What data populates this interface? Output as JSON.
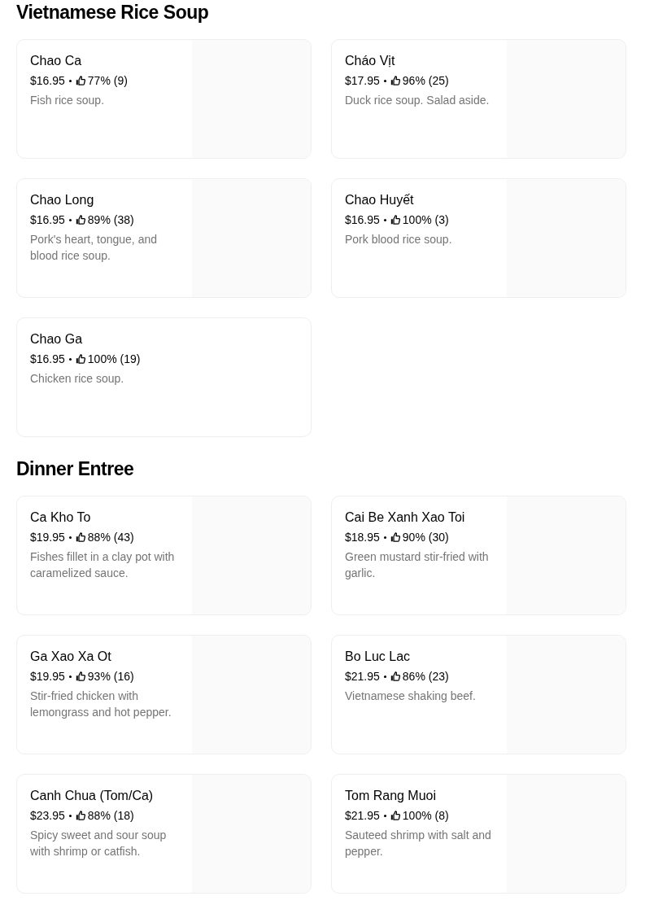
{
  "sections": [
    {
      "title": "Vietnamese Rice Soup",
      "items": [
        {
          "kind": "with-image",
          "name": "Chao Ca",
          "price": "$16.95",
          "rating": "77% (9)",
          "description": "Fish rice soup."
        },
        {
          "kind": "with-image",
          "name": "Cháo Vịt",
          "price": "$17.95",
          "rating": "96% (25)",
          "description": "Duck rice soup. Salad aside."
        },
        {
          "kind": "with-image",
          "name": "Chao Long",
          "price": "$16.95",
          "rating": "89% (38)",
          "description": "Pork's heart, tongue, and blood rice soup."
        },
        {
          "kind": "with-image",
          "name": "Chao Huyết",
          "price": "$16.95",
          "rating": "100% (3)",
          "description": "Pork blood rice soup."
        },
        {
          "kind": "text-only",
          "name": "Chao Ga",
          "price": "$16.95",
          "rating": "100% (19)",
          "description": "Chicken rice soup."
        }
      ]
    },
    {
      "title": "Dinner Entree",
      "items": [
        {
          "kind": "with-image",
          "name": "Ca Kho To",
          "price": "$19.95",
          "rating": "88% (43)",
          "description": "Fishes fillet in a clay pot with caramelized sauce."
        },
        {
          "kind": "with-image",
          "name": "Cai Be Xanh Xao Toi",
          "price": "$18.95",
          "rating": "90% (30)",
          "description": "Green mustard stir-fried with garlic."
        },
        {
          "kind": "with-image",
          "name": "Ga Xao Xa Ot",
          "price": "$19.95",
          "rating": "93% (16)",
          "description": "Stir-fried chicken with lemongrass and hot pepper."
        },
        {
          "kind": "with-image",
          "name": "Bo Luc Lac",
          "price": "$21.95",
          "rating": "86% (23)",
          "description": "Vietnamese shaking beef."
        },
        {
          "kind": "with-image",
          "name": "Canh Chua (Tom/Ca)",
          "price": "$23.95",
          "rating": "88% (18)",
          "description": "Spicy sweet and sour soup with shrimp or catfish."
        },
        {
          "kind": "with-image",
          "name": "Tom Rang Muoi",
          "price": "$21.95",
          "rating": "100% (8)",
          "description": "Sauteed shrimp with salt and pepper."
        }
      ]
    }
  ]
}
